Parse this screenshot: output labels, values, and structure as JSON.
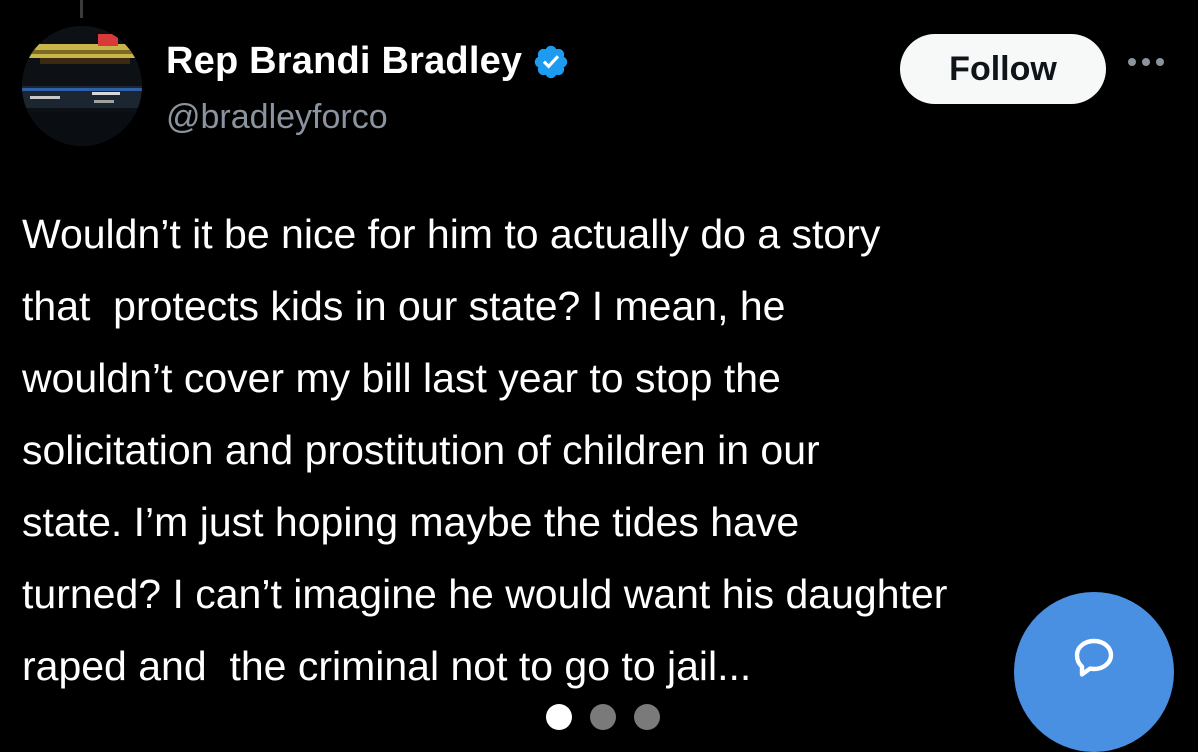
{
  "author": {
    "display_name": "Rep Brandi Bradley",
    "handle": "@bradleyforco",
    "verified": true,
    "avatar_icon": "tv-broadcast-screenshot-avatar"
  },
  "actions": {
    "follow_label": "Follow",
    "more_icon": "more-horizontal-icon",
    "reply_icon": "chat-bubble-icon"
  },
  "tweet": {
    "text": "Wouldn’t it be nice for him to actually do a story\nthat  protects kids in our state? I mean, he\nwouldn’t cover my bill last year to stop the\nsolicitation and prostitution of children in our\nstate. I’m just hoping maybe the tides have\nturned? I can’t imagine he would want his daughter\nraped and  the criminal not to go to jail..."
  },
  "pager": {
    "count": 3,
    "active_index": 0
  },
  "colors": {
    "background": "#000000",
    "text": "#ffffff",
    "handle": "#8b949e",
    "verified_badge": "#1d9bf0",
    "reply_fab": "#4a90e2",
    "follow_bg": "#f7f9f9"
  }
}
